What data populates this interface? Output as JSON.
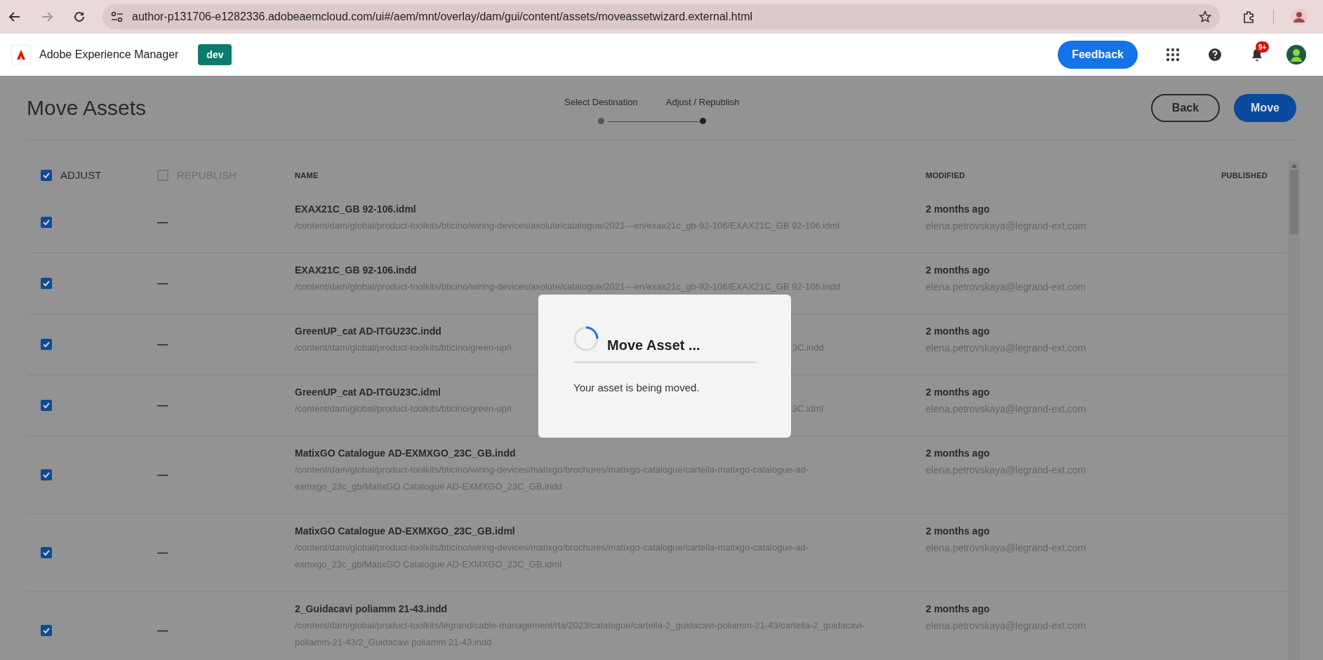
{
  "browser": {
    "url": "author-p131706-e1282336.adobeaemcloud.com/ui#/aem/mnt/overlay/dam/gui/content/assets/moveassetwizard.external.html"
  },
  "app": {
    "product": "Adobe Experience Manager",
    "environment": "dev",
    "feedback": "Feedback",
    "notification_badge": "9+"
  },
  "page": {
    "title": "Move Assets",
    "steps": [
      {
        "label": "Select Destination",
        "selected": false
      },
      {
        "label": "Adjust / Republish",
        "selected": true
      }
    ],
    "back": "Back",
    "move": "Move"
  },
  "table": {
    "columns": [
      {
        "kind": "check",
        "label": "ADJUST",
        "checked": true
      },
      {
        "kind": "check",
        "label": "REPUBLISH",
        "checked": false
      },
      {
        "kind": "text",
        "label": "NAME"
      },
      {
        "kind": "text",
        "label": "MODIFIED"
      },
      {
        "kind": "text",
        "label": "PUBLISHED"
      }
    ],
    "rows": [
      {
        "adjust": true,
        "republish": "—",
        "name": "EXAX21C_GB 92-106.idml",
        "path": [
          "/content/dam/global/product-toolkits/bticino/wiring-devices/axolute/catalogue/2021---en/exax21c_gb-92-106/EXAX21C_GB 92-106.idml"
        ],
        "modified": "2 months ago",
        "user": "elena.petrovskaya@legrand-ext.com"
      },
      {
        "adjust": true,
        "republish": "—",
        "name": "EXAX21C_GB 92-106.indd",
        "path": [
          "/content/dam/global/product-toolkits/bticino/wiring-devices/axolute/catalogue/2021---en/exax21c_gb-92-106/EXAX21C_GB 92-106.indd"
        ],
        "modified": "2 months ago",
        "user": "elena.petrovskaya@legrand-ext.com"
      },
      {
        "adjust": true,
        "republish": "—",
        "name": "GreenUP_cat AD-ITGU23C.indd",
        "path": [
          "/content/dam/global/product-toolkits/bticino/green-up/i",
          "3C.indd"
        ],
        "modified": "2 months ago",
        "user": "elena.petrovskaya@legrand-ext.com"
      },
      {
        "adjust": true,
        "republish": "—",
        "name": "GreenUP_cat AD-ITGU23C.idml",
        "path": [
          "/content/dam/global/product-toolkits/bticino/green-up/i",
          "3C.idml"
        ],
        "modified": "2 months ago",
        "user": "elena.petrovskaya@legrand-ext.com"
      },
      {
        "adjust": true,
        "republish": "—",
        "name": "MatixGO Catalogue AD-EXMXGO_23C_GB.indd",
        "path": [
          "/content/dam/global/product-toolkits/bticino/wiring-devices/matixgo/brochures/matixgo-catalogue/cartella-matixgo-catalogue-ad-exmxgo_23c_gb/MatixGO Catalogue AD-EXMXGO_23C_GB.indd"
        ],
        "modified": "2 months ago",
        "user": "elena.petrovskaya@legrand-ext.com"
      },
      {
        "adjust": true,
        "republish": "—",
        "name": "MatixGO Catalogue AD-EXMXGO_23C_GB.idml",
        "path": [
          "/content/dam/global/product-toolkits/bticino/wiring-devices/matixgo/brochures/matixgo-catalogue/cartella-matixgo-catalogue-ad-exmxgo_23c_gb/MatixGO Catalogue AD-EXMXGO_23C_GB.idml"
        ],
        "modified": "2 months ago",
        "user": "elena.petrovskaya@legrand-ext.com"
      },
      {
        "adjust": true,
        "republish": "—",
        "name": "2_Guidacavi poliamm 21-43.indd",
        "path": [
          "/content/dam/global/product-toolkits/legrand/cable-management/rta/2023/catalogue/cartella-2_guidacavi-poliamm-21-43/cartella-2_guidacavi-poliamm-21-43/2_Guidacavi poliamm 21-43.indd"
        ],
        "modified": "2 months ago",
        "user": "elena.petrovskaya@legrand-ext.com"
      }
    ]
  },
  "modal": {
    "title": "Move Asset ...",
    "message": "Your asset is being moved."
  }
}
